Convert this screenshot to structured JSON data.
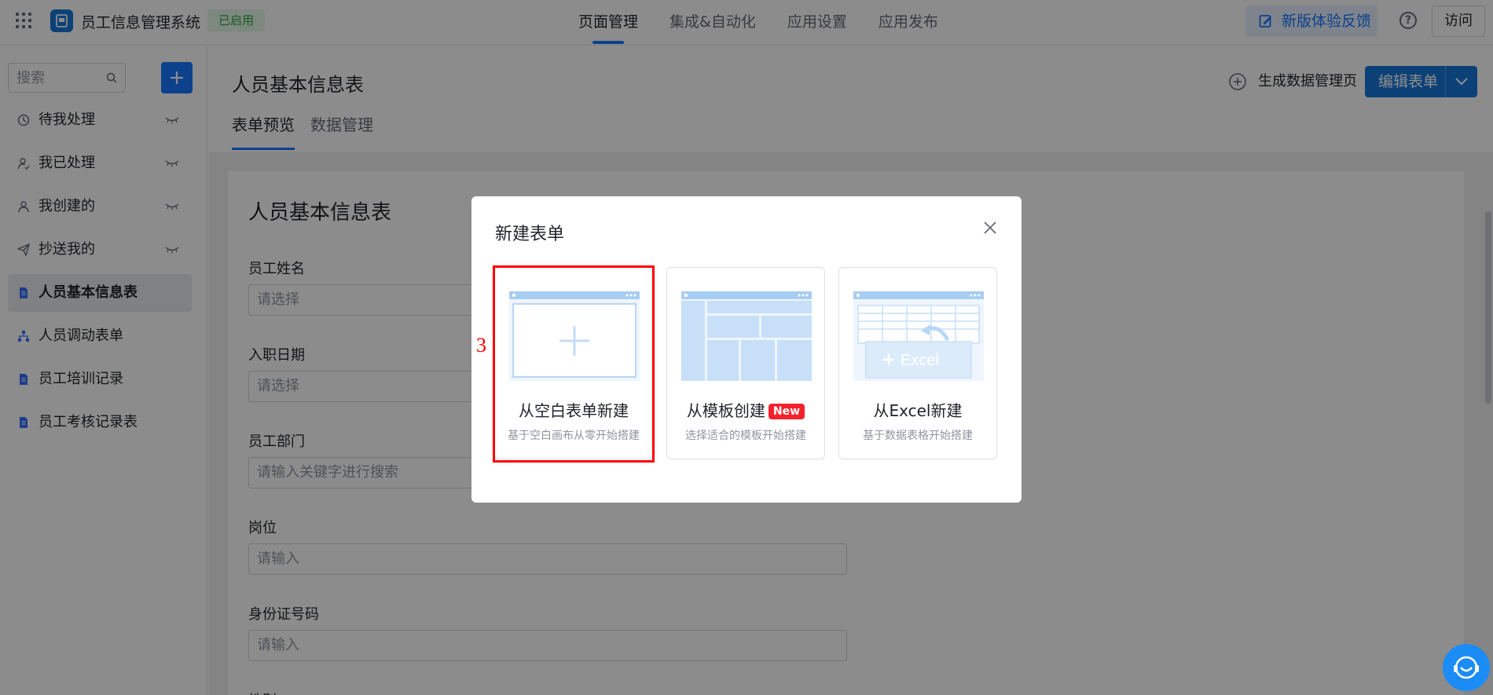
{
  "header": {
    "app_name": "员工信息管理系统",
    "status_badge": "已启用",
    "nav_tabs": [
      "页面管理",
      "集成&自动化",
      "应用设置",
      "应用发布"
    ],
    "active_tab": "页面管理",
    "feedback_label": "新版体验反馈",
    "help_label": "?",
    "visit_label": "访问"
  },
  "sidebar": {
    "search_placeholder": "搜索",
    "items": [
      {
        "label": "待我处理",
        "icon": "clock-icon"
      },
      {
        "label": "我已处理",
        "icon": "user-check-icon"
      },
      {
        "label": "我创建的",
        "icon": "user-icon"
      },
      {
        "label": "抄送我的",
        "icon": "send-icon"
      },
      {
        "label": "人员基本信息表",
        "icon": "form-doc-icon",
        "active": true
      },
      {
        "label": "人员调动表单",
        "icon": "org-chart-icon"
      },
      {
        "label": "员工培训记录",
        "icon": "form-doc-icon"
      },
      {
        "label": "员工考核记录表",
        "icon": "form-doc-icon"
      }
    ]
  },
  "main": {
    "page_title": "人员基本信息表",
    "generate_data_page": "生成数据管理页",
    "edit_form": "编辑表单",
    "sub_tabs": [
      "表单预览",
      "数据管理"
    ],
    "active_sub_tab": "表单预览",
    "form": {
      "title": "人员基本信息表",
      "fields": [
        {
          "label": "员工姓名",
          "placeholder": "请选择"
        },
        {
          "label": "入职日期",
          "placeholder": "请选择"
        },
        {
          "label": "员工部门",
          "placeholder": "请输入关键字进行搜索"
        },
        {
          "label": "岗位",
          "placeholder": "请输入"
        },
        {
          "label": "身份证号码",
          "placeholder": "请输入"
        },
        {
          "label": "性别",
          "placeholder": ""
        }
      ]
    }
  },
  "modal": {
    "title": "新建表单",
    "options": [
      {
        "name": "从空白表单新建",
        "desc": "基于空白画布从零开始搭建"
      },
      {
        "name": "从模板创建",
        "badge": "New",
        "desc": "选择适合的模板开始搭建"
      },
      {
        "name": "从Excel新建",
        "desc": "基于数据表格开始搭建",
        "illustration_text": "Excel"
      }
    ]
  },
  "annotation": {
    "step_number": "3",
    "color": "#ff0000"
  },
  "colors": {
    "primary": "#1677ff",
    "badge_green": "#2ba84a",
    "new_badge": "#f5222d"
  }
}
